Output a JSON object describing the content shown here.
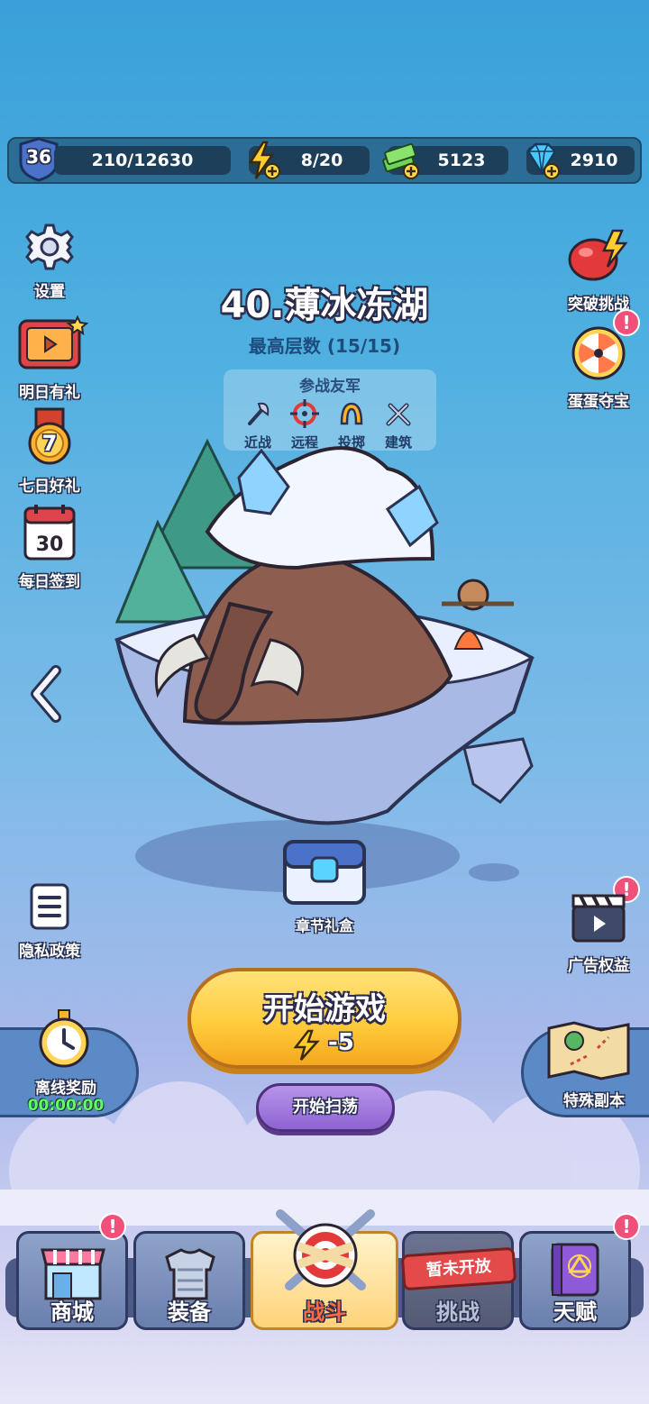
{
  "resources": {
    "level": "36",
    "exp": "210/12630",
    "energy": "8/20",
    "cash": "5123",
    "gems": "2910"
  },
  "left_menu": [
    {
      "label": "设置",
      "icon": "gear-icon"
    },
    {
      "label": "明日有礼",
      "icon": "tv-gift-icon"
    },
    {
      "label": "七日好礼",
      "icon": "medal-icon",
      "badge": "7"
    },
    {
      "label": "每日签到",
      "icon": "calendar-icon",
      "badge": "30"
    }
  ],
  "right_menu": [
    {
      "label": "突破挑战",
      "icon": "boxing-glove-icon"
    },
    {
      "label": "蛋蛋夺宝",
      "icon": "wheel-icon"
    }
  ],
  "stage": {
    "title": "40.薄冰冻湖",
    "best_floor": "最高层数 (15/15)",
    "allies_title": "参战友军",
    "allies": [
      {
        "label": "近战",
        "icon": "axe-icon"
      },
      {
        "label": "远程",
        "icon": "crosshair-icon"
      },
      {
        "label": "投掷",
        "icon": "boomerang-icon"
      },
      {
        "label": "建筑",
        "icon": "tools-icon"
      }
    ]
  },
  "chest_label": "章节礼盒",
  "privacy_label": "隐私政策",
  "ad_label": "广告权益",
  "start": {
    "label": "开始游戏",
    "cost": "-5"
  },
  "sweep_label": "开始扫荡",
  "offline": {
    "label": "离线奖励",
    "timer": "00:00:00"
  },
  "special_label": "特殊副本",
  "nav": [
    {
      "label": "商城",
      "icon": "shop-icon"
    },
    {
      "label": "装备",
      "icon": "armor-icon"
    },
    {
      "label": "战斗",
      "icon": "target-swords-icon"
    },
    {
      "label": "挑战",
      "icon": "challenge-icon"
    },
    {
      "label": "天赋",
      "icon": "spellbook-icon"
    }
  ],
  "locked_tag": "暂未开放",
  "alert_mark": "!",
  "colors": {
    "accent": "#ffcc3d",
    "sky": "#4fb0e0",
    "alert": "#f0517a"
  }
}
